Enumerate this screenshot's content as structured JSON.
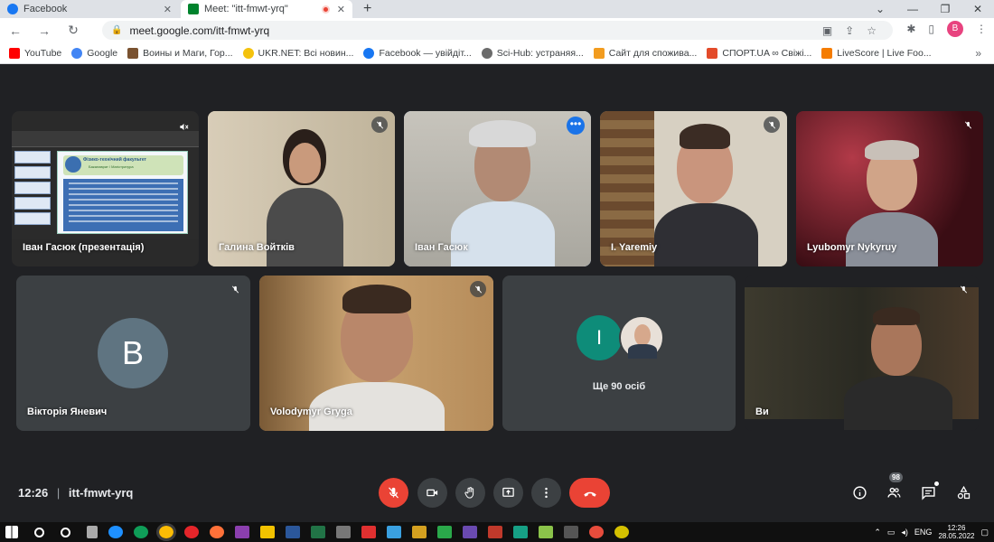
{
  "browser": {
    "tabs": [
      {
        "title": "Facebook",
        "icon_color": "#1877f2",
        "active": false
      },
      {
        "title": "Meet: \"itt-fmwt-yrq\"",
        "icon_color": "#00832d",
        "active": true
      }
    ],
    "new_tab": "+",
    "window_controls": [
      "⌄",
      "—",
      "❐",
      "✕"
    ],
    "nav": {
      "back": "←",
      "forward": "→",
      "reload": "↻"
    },
    "url": "meet.google.com/itt-fmwt-yrq",
    "profile_initial": "B",
    "bookmarks": [
      {
        "label": "YouTube",
        "icon_color": "#ff0000"
      },
      {
        "label": "Google",
        "icon_color": "#4285f4"
      },
      {
        "label": "Воины и Маги, Гор...",
        "icon_color": "#7a5230"
      },
      {
        "label": "UKR.NET: Всі новин...",
        "icon_color": "#f4c20d"
      },
      {
        "label": "Facebook — увійдіт...",
        "icon_color": "#1877f2"
      },
      {
        "label": "Sci-Hub: устраняя...",
        "icon_color": "#6b6b6b"
      },
      {
        "label": "Сайт для спожива...",
        "icon_color": "#f29c1f"
      },
      {
        "label": "СПОРТ.UA ∞ Свіжі...",
        "icon_color": "#e34b2a"
      },
      {
        "label": "LiveScore | Live Foo...",
        "icon_color": "#f57c00"
      }
    ],
    "bookmarks_more": "»"
  },
  "meet": {
    "row1": [
      {
        "name": "Іван Гасюк (презентація)",
        "type": "presentation"
      },
      {
        "name": "Галина Войтків",
        "type": "video"
      },
      {
        "name": "Іван Гасюк",
        "type": "video",
        "speaking": true
      },
      {
        "name": "I. Yaremiy",
        "type": "video"
      },
      {
        "name": "Lyubomyr Nykyruy",
        "type": "video"
      }
    ],
    "row2": [
      {
        "name": "Вікторія Яневич",
        "type": "avatar",
        "initial": "B"
      },
      {
        "name": "Volodymyr Gryga",
        "type": "video"
      },
      {
        "name": "Ще 90 осіб",
        "type": "more",
        "initial": "I"
      },
      {
        "name": "Ви",
        "type": "video"
      }
    ],
    "presentation": {
      "title": "Фізико-технічний факультет",
      "subtitle": "Бакалаврат / Магістратура"
    },
    "meeting_time": "12:26",
    "meeting_code": "itt-fmwt-yrq",
    "separator": "|",
    "participants_count": "98",
    "more_dots": "•••"
  },
  "taskbar": {
    "language": "ENG",
    "time": "12:26",
    "date": "28.05.2022"
  },
  "colors": {
    "meet_bg": "#202124",
    "tile_bg": "#3c4043",
    "danger": "#ea4335",
    "speaker_outline": "#8ab4f8"
  }
}
